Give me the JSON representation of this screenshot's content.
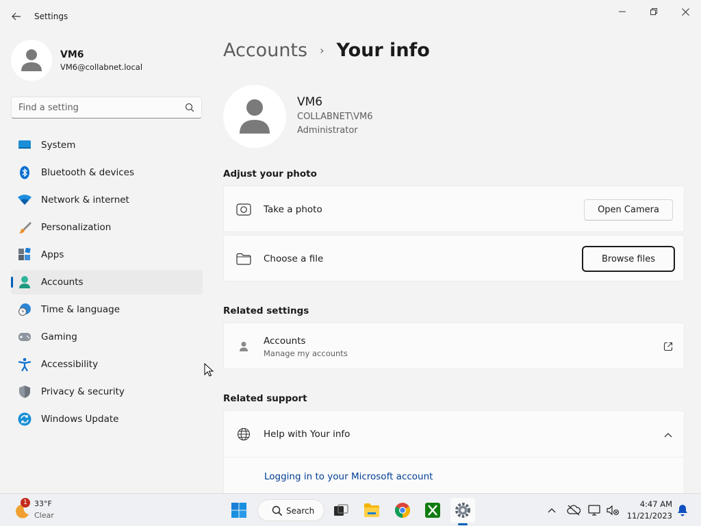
{
  "window": {
    "title": "Settings",
    "back_icon": "arrow-left-icon",
    "minimize_icon": "minimize-icon",
    "maximize_icon": "restore-icon",
    "close_icon": "close-icon"
  },
  "user": {
    "name": "VM6",
    "email": "VM6@collabnet.local",
    "avatar_icon": "person-icon"
  },
  "search": {
    "placeholder": "Find a setting",
    "value": "",
    "icon": "search-icon"
  },
  "nav": {
    "items": [
      {
        "label": "System",
        "icon": "system-display-icon",
        "active": false
      },
      {
        "label": "Bluetooth & devices",
        "icon": "bluetooth-icon",
        "active": false
      },
      {
        "label": "Network & internet",
        "icon": "wifi-icon",
        "active": false
      },
      {
        "label": "Personalization",
        "icon": "paintbrush-icon",
        "active": false
      },
      {
        "label": "Apps",
        "icon": "apps-icon",
        "active": false
      },
      {
        "label": "Accounts",
        "icon": "accounts-person-icon",
        "active": true
      },
      {
        "label": "Time & language",
        "icon": "globe-clock-icon",
        "active": false
      },
      {
        "label": "Gaming",
        "icon": "gamepad-icon",
        "active": false
      },
      {
        "label": "Accessibility",
        "icon": "accessibility-icon",
        "active": false
      },
      {
        "label": "Privacy & security",
        "icon": "shield-icon",
        "active": false
      },
      {
        "label": "Windows Update",
        "icon": "update-icon",
        "active": false
      }
    ]
  },
  "main": {
    "breadcrumb": {
      "parent": "Accounts",
      "separator": "›",
      "current": "Your info"
    },
    "profile": {
      "name": "VM6",
      "domain": "COLLABNET\\VM6",
      "role": "Administrator"
    },
    "adjust_photo": {
      "title": "Adjust your photo",
      "take_photo_label": "Take a photo",
      "take_photo_button": "Open Camera",
      "choose_file_label": "Choose a file",
      "choose_file_button": "Browse files"
    },
    "related_settings": {
      "title": "Related settings",
      "accounts_label": "Accounts",
      "accounts_sub": "Manage my accounts"
    },
    "related_support": {
      "title": "Related support",
      "help_label": "Help with Your info",
      "link": "Logging in to your Microsoft account"
    }
  },
  "taskbar": {
    "weather": {
      "temp": "33°F",
      "condition": "Clear",
      "badge": "1"
    },
    "search_label": "Search",
    "clock": {
      "time": "4:47 AM",
      "date": "11/21/2023"
    }
  },
  "colors": {
    "accent": "#005fb8",
    "link": "#003e92",
    "background": "#f3f3f3",
    "card": "#fbfbfb"
  }
}
